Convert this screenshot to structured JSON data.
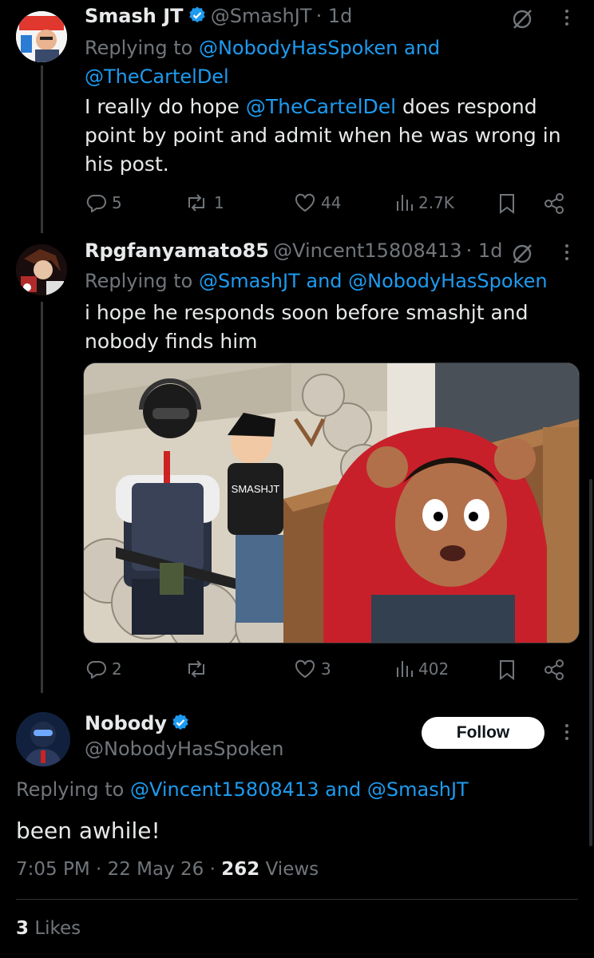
{
  "tweet1": {
    "name": "Smash JT",
    "handle": "@SmashJT",
    "time": "· 1d",
    "replying_prefix": "Replying to",
    "replying_user1": "@NobodyHasSpoken",
    "replying_and": "and",
    "replying_user2": "@TheCartelDel",
    "text_before": "I really do hope ",
    "text_mention": "@TheCartelDel",
    "text_after": " does respond point by point and admit when he was wrong in his post.",
    "replies": "5",
    "retweets": "1",
    "likes": "44",
    "views": "2.7K"
  },
  "tweet2": {
    "name": "Rpgfanyamato85",
    "handle": "@Vincent15808413",
    "time": "· 1d",
    "replying_prefix": "Replying to",
    "replying_user1": "@SmashJT",
    "replying_and": "and",
    "replying_user2": "@NobodyHasSpoken",
    "text": "i hope he responds soon before smashjt and nobody finds him",
    "image_shirt_text": "SMASHJT",
    "replies": "2",
    "retweets": "",
    "likes": "3",
    "views": "402"
  },
  "main_tweet": {
    "name": "Nobody",
    "handle": "@NobodyHasSpoken",
    "follow_label": "Follow",
    "replying_prefix": "Replying to",
    "replying_user1": "@Vincent15808413",
    "replying_and": "and",
    "replying_user2": "@SmashJT",
    "text": "been awhile!",
    "timestamp": "7:05 PM · 22 May 26 · ",
    "views_count": "262",
    "views_label": " Views",
    "likes_count": "3",
    "likes_label": " Likes"
  },
  "colors": {
    "accent": "#1d9bf0",
    "muted": "#71767b",
    "text": "#e7e9ea",
    "background": "#000000"
  }
}
